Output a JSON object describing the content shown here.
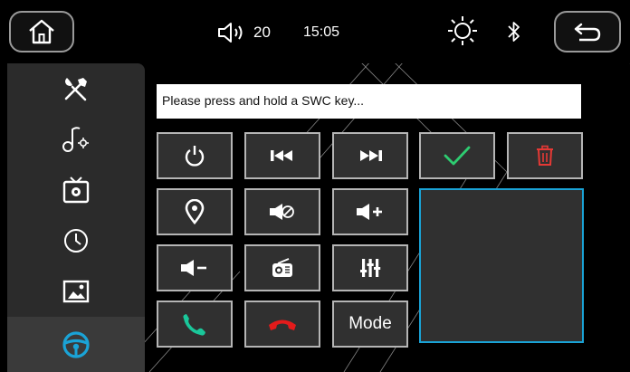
{
  "status": {
    "volume": "20",
    "time": "15:05"
  },
  "sidebar": {
    "items": [
      {
        "icon": "tools-icon"
      },
      {
        "icon": "music-settings-icon"
      },
      {
        "icon": "tv-settings-icon"
      },
      {
        "icon": "clock-icon"
      },
      {
        "icon": "wallpaper-icon"
      },
      {
        "icon": "steering-wheel-icon",
        "active": true
      }
    ]
  },
  "hint": {
    "text": "Please press and hold a SWC key..."
  },
  "keys": {
    "mode_label": "Mode"
  },
  "colors": {
    "accept": "#2ecc71",
    "delete": "#e53935",
    "call_green": "#1ac79a",
    "hangup_red": "#e41b1b",
    "steering_blue": "#1aa3d6",
    "panel_border": "#1aa3d6"
  }
}
